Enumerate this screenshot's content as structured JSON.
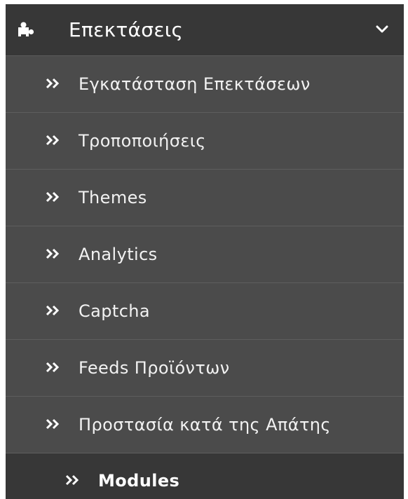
{
  "menu": {
    "title": "Επεκτάσεις",
    "icon": "puzzle-icon",
    "toggle_icon": "chevron-down-icon",
    "bg_color": "#4b4b4b",
    "header_color": "#373737",
    "items": [
      {
        "label": "Εγκατάσταση Επεκτάσεων"
      },
      {
        "label": "Τροποποιήσεις"
      },
      {
        "label": "Themes"
      },
      {
        "label": "Analytics"
      },
      {
        "label": "Captcha"
      },
      {
        "label": "Feeds Προϊόντων"
      },
      {
        "label": "Προστασία κατά της Απάτης"
      },
      {
        "label": "Modules",
        "active": true
      }
    ]
  }
}
